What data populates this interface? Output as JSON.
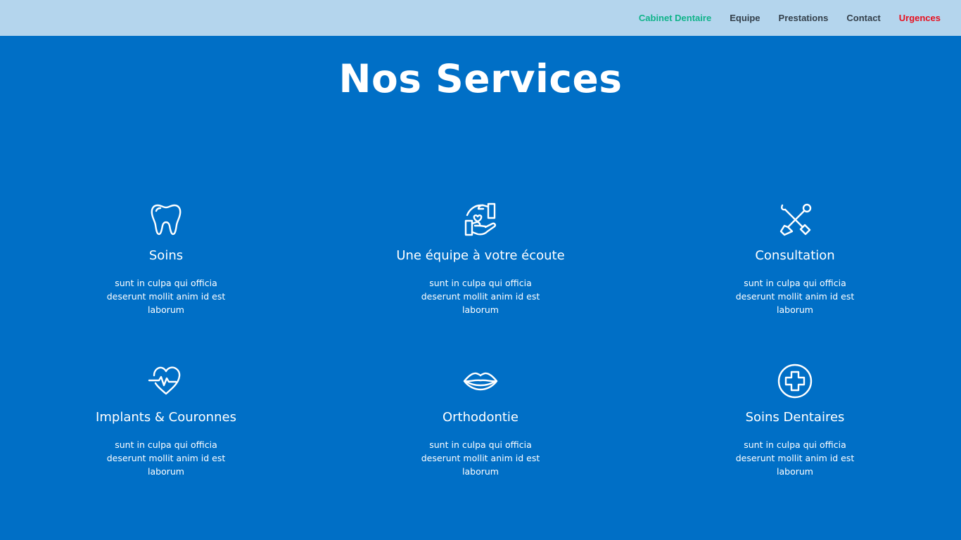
{
  "nav": {
    "brand": "Cabinet Dentaire",
    "items": [
      "Equipe",
      "Prestations",
      "Contact"
    ],
    "urgent": "Urgences"
  },
  "main": {
    "title": "Nos Services"
  },
  "services": [
    {
      "name": "Soins",
      "desc": "sunt in culpa qui officia deserunt mollit anim id est laborum",
      "icon": "tooth-icon"
    },
    {
      "name": "Une équipe à votre écoute",
      "desc": "sunt in culpa qui officia deserunt mollit anim id est laborum",
      "icon": "hand-heart-icon"
    },
    {
      "name": "Consultation",
      "desc": "sunt in culpa qui officia deserunt mollit anim id est laborum",
      "icon": "dental-tools-icon"
    },
    {
      "name": "Implants & Couronnes",
      "desc": "sunt in culpa qui officia deserunt mollit anim id est laborum",
      "icon": "heart-pulse-icon"
    },
    {
      "name": "Orthodontie",
      "desc": "sunt in culpa qui officia deserunt mollit anim id est laborum",
      "icon": "lips-icon"
    },
    {
      "name": "Soins Dentaires",
      "desc": "sunt in culpa qui officia deserunt mollit anim id est laborum",
      "icon": "medical-cross-icon"
    }
  ],
  "colors": {
    "background": "#006fc6",
    "topbar": "#b4d5ed",
    "brand": "#10b38a",
    "urgent": "#e8101f",
    "nav_text": "#333f4a"
  }
}
